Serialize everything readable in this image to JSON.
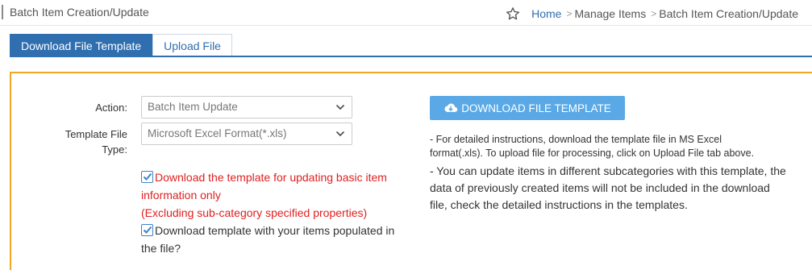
{
  "header": {
    "title": "Batch Item Creation/Update",
    "breadcrumb": {
      "home": "Home",
      "sep": ">",
      "manage": "Manage Items",
      "current": "Batch Item Creation/Update"
    }
  },
  "tabs": [
    {
      "label": "Download File Template",
      "active": true
    },
    {
      "label": "Upload File",
      "active": false
    }
  ],
  "form": {
    "action_label": "Action:",
    "action_value": "Batch Item Update",
    "template_label_line1": "Template File",
    "template_label_line2": "Type:",
    "template_value": "Microsoft Excel Format(*.xls)",
    "checkbox1": {
      "checked": true,
      "line1": "Download the template for updating basic item",
      "line2": "information only",
      "line3": "(Excluding sub-category specified properties)"
    },
    "checkbox2": {
      "checked": true,
      "line1": "Download template with your items populated in",
      "line2": "the file?"
    }
  },
  "download_button": "DOWNLOAD FILE TEMPLATE",
  "instructions": {
    "p1_line1": "- For detailed instructions, download the template file in MS Excel",
    "p1_line2": "format(.xls). To upload file for processing, click on Upload File tab above.",
    "p2_line1": "- You can update items in different subcategories with this template, the",
    "p2_line2": "data of previously created items will not be included in the download",
    "p2_line3": "file, check the detailed instructions in the templates."
  },
  "colors": {
    "accent": "#2f6fb0",
    "panel_border": "#f5a623",
    "button": "#5aa9e6",
    "warning_text": "#e02020"
  }
}
